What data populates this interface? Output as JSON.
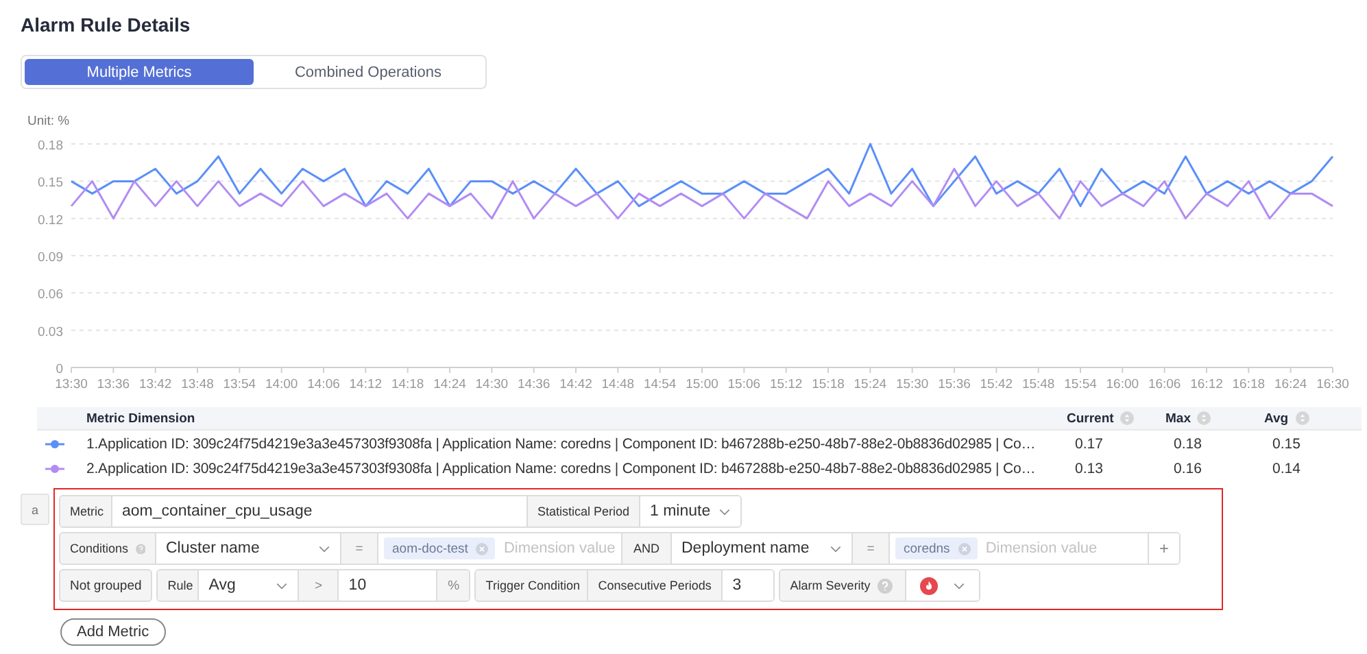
{
  "title": "Alarm Rule Details",
  "mode_tabs": [
    {
      "label": "Multiple Metrics",
      "selected": true
    },
    {
      "label": "Combined Operations",
      "selected": false
    }
  ],
  "chart": {
    "unit_label": "Unit: %",
    "chart_data": {
      "type": "line",
      "categories": [
        "13:30",
        null,
        "13:36",
        null,
        "13:42",
        null,
        "13:48",
        null,
        "13:54",
        null,
        "14:00",
        null,
        "14:06",
        null,
        "14:12",
        null,
        "14:18",
        null,
        "14:24",
        null,
        "14:30",
        null,
        "14:36",
        null,
        "14:42",
        null,
        "14:48",
        null,
        "14:54",
        null,
        "15:00",
        null,
        "15:06",
        null,
        "15:12",
        null,
        "15:18",
        null,
        "15:24",
        null,
        "15:30",
        null,
        "15:36",
        null,
        "15:42",
        null,
        "15:48",
        null,
        "15:54",
        null,
        "16:00",
        null,
        "16:06",
        null,
        "16:12",
        null,
        "16:18",
        null,
        "16:24",
        null,
        "16:30"
      ],
      "series": [
        {
          "color": "#5b8ff9",
          "values": [
            0.15,
            0.14,
            0.15,
            0.15,
            0.16,
            0.14,
            0.15,
            0.17,
            0.14,
            0.16,
            0.14,
            0.16,
            0.15,
            0.16,
            0.13,
            0.15,
            0.14,
            0.16,
            0.13,
            0.15,
            0.15,
            0.14,
            0.15,
            0.14,
            0.16,
            0.14,
            0.15,
            0.13,
            0.14,
            0.15,
            0.14,
            0.14,
            0.15,
            0.14,
            0.14,
            0.15,
            0.16,
            0.14,
            0.18,
            0.14,
            0.16,
            0.13,
            0.15,
            0.17,
            0.14,
            0.15,
            0.14,
            0.16,
            0.13,
            0.16,
            0.14,
            0.15,
            0.14,
            0.17,
            0.14,
            0.15,
            0.14,
            0.15,
            0.14,
            0.15,
            0.17
          ]
        },
        {
          "color": "#b18cf3",
          "values": [
            0.13,
            0.15,
            0.12,
            0.15,
            0.13,
            0.15,
            0.13,
            0.15,
            0.13,
            0.14,
            0.13,
            0.15,
            0.13,
            0.14,
            0.13,
            0.14,
            0.12,
            0.14,
            0.13,
            0.14,
            0.12,
            0.15,
            0.12,
            0.14,
            0.13,
            0.14,
            0.12,
            0.14,
            0.13,
            0.14,
            0.13,
            0.14,
            0.12,
            0.14,
            0.13,
            0.12,
            0.15,
            0.13,
            0.14,
            0.13,
            0.15,
            0.13,
            0.16,
            0.13,
            0.15,
            0.13,
            0.14,
            0.12,
            0.15,
            0.13,
            0.14,
            0.13,
            0.15,
            0.12,
            0.14,
            0.13,
            0.15,
            0.12,
            0.14,
            0.14,
            0.13
          ]
        }
      ],
      "ylim": [
        0,
        0.18
      ],
      "grid": true,
      "yticks": [
        0,
        0.03,
        0.06,
        0.09,
        0.12,
        0.15,
        0.18
      ]
    }
  },
  "legend_table": {
    "columns": [
      {
        "label": "Metric Dimension",
        "sortable": false
      },
      {
        "label": "Current",
        "sortable": true
      },
      {
        "label": "Max",
        "sortable": true
      },
      {
        "label": "Avg",
        "sortable": true
      }
    ],
    "rows": [
      {
        "color": "#5b8ff9",
        "dimension": "1.Application ID: 309c24f75d4219e3a3e457303f9308fa | Application Name: coredns | Component ID: b467288b-e250-48b7-88e2-0b8836d02985 | Co…",
        "current": "0.17",
        "max": "0.18",
        "avg": "0.15"
      },
      {
        "color": "#b18cf3",
        "dimension": "2.Application ID: 309c24f75d4219e3a3e457303f9308fa | Application Name: coredns | Component ID: b467288b-e250-48b7-88e2-0b8836d02985 | Co…",
        "current": "0.13",
        "max": "0.16",
        "avg": "0.14"
      }
    ]
  },
  "metric_rule": {
    "id_label": "a",
    "metric": {
      "label": "Metric",
      "value": "aom_container_cpu_usage"
    },
    "period": {
      "label": "Statistical Period",
      "value": "1 minute"
    },
    "conditions": {
      "label": "Conditions",
      "clauses": [
        {
          "dimension": "Cluster name",
          "operator": "=",
          "tags": [
            "aom-doc-test"
          ],
          "placeholder": "Dimension value"
        },
        {
          "joiner": "AND",
          "dimension": "Deployment name",
          "operator": "=",
          "tags": [
            "coredns"
          ],
          "placeholder": "Dimension value"
        }
      ],
      "add_label": "+"
    },
    "grouping": "Not grouped",
    "rule": {
      "label": "Rule",
      "aggregation": "Avg",
      "comparator": ">",
      "threshold": "10",
      "unit": "%"
    },
    "trigger": {
      "label": "Trigger Condition",
      "periods_label": "Consecutive Periods",
      "periods": "3"
    },
    "severity": {
      "label": "Alarm Severity"
    }
  },
  "add_metric_button": "Add Metric"
}
